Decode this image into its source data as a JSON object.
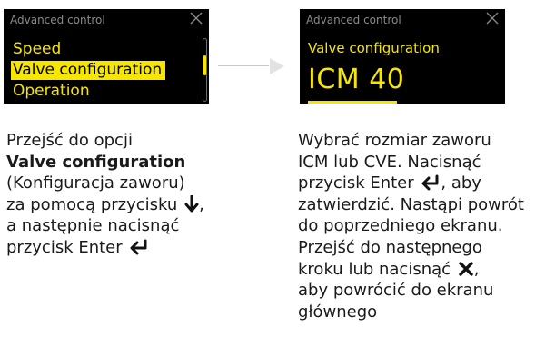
{
  "screen_left": {
    "title": "Advanced control",
    "close_icon": "close-icon",
    "menu_items": [
      {
        "label": "Speed",
        "selected": false
      },
      {
        "label": "Valve configuration",
        "selected": true
      },
      {
        "label": "Operation",
        "selected": false
      }
    ]
  },
  "screen_right": {
    "title": "Advanced control",
    "close_icon": "close-icon",
    "subtitle": "Valve configuration",
    "value": "ICM 40"
  },
  "colors": {
    "display_bg": "#000000",
    "accent": "#f6e600",
    "title_gray": "#8a8a8a",
    "connector": "#c8c8c8"
  },
  "instructions_left": {
    "line1": "Przejść do opcji",
    "line2_bold": "Valve configuration",
    "line3": "(Konfiguracja zaworu)",
    "line4": "za pomocą przycisku",
    "line4_icon": "down-arrow-icon",
    "line4_suffix": ",",
    "line5": "a następnie nacisnąć",
    "line6": "przycisk Enter",
    "line6_icon": "enter-icon"
  },
  "instructions_right": {
    "line1": "Wybrać rozmiar zaworu",
    "line2": "ICM lub CVE. Nacisnąć",
    "line3_pre": "przycisk Enter",
    "line3_icon": "enter-icon",
    "line3_post": ", aby",
    "line4": "zatwierdzić. Nastąpi powrót",
    "line5": "do poprzedniego ekranu.",
    "line6": "Przejść do następnego",
    "line7_pre": "kroku lub nacisnąć",
    "line7_icon": "x-icon",
    "line7_post": ",",
    "line8": "aby powrócić do ekranu",
    "line9": "głównego"
  }
}
